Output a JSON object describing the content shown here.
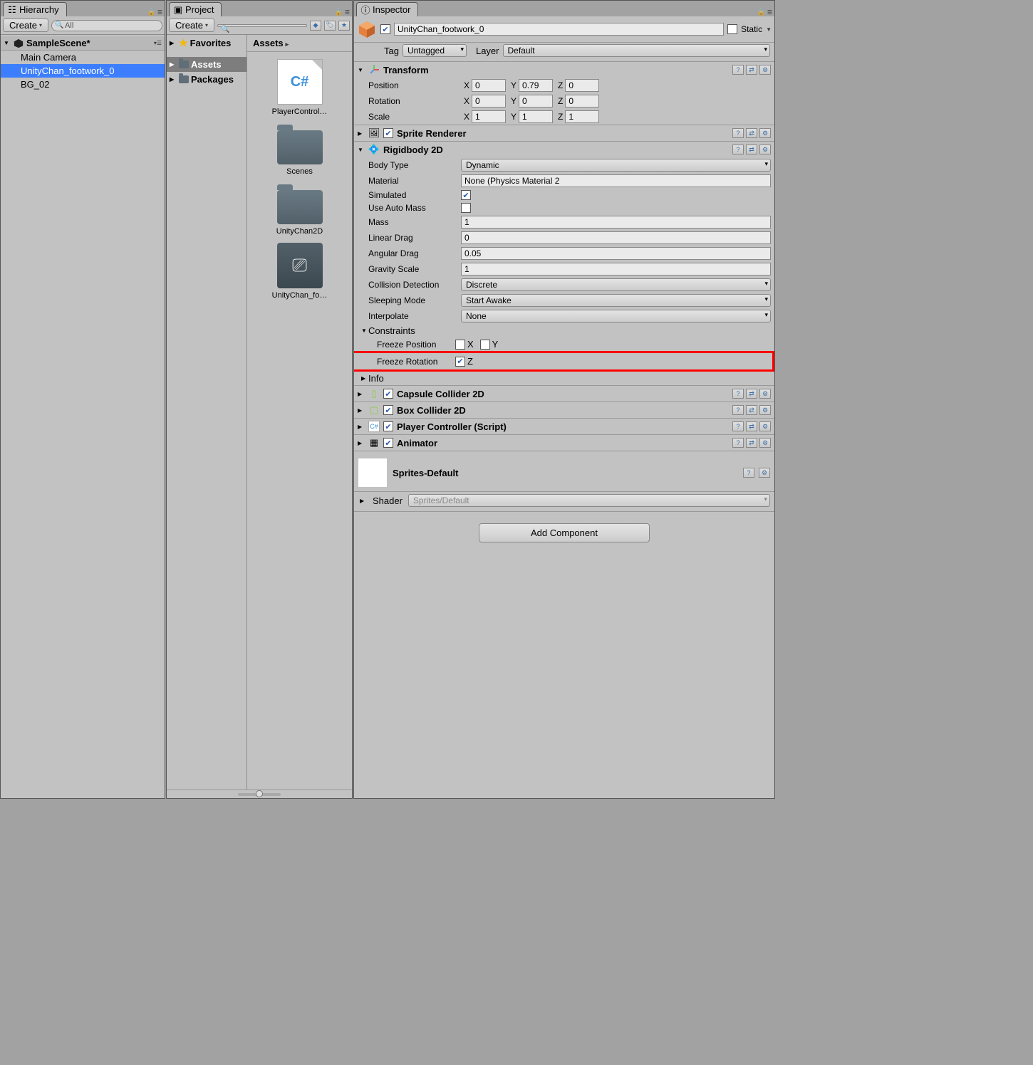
{
  "hierarchy": {
    "tab": "Hierarchy",
    "create": "Create",
    "search_placeholder": "All",
    "scene": "SampleScene*",
    "items": [
      "Main Camera",
      "UnityChan_footwork_0",
      "BG_02"
    ],
    "selected_index": 1
  },
  "project": {
    "tab": "Project",
    "create": "Create",
    "favorites": "Favorites",
    "folders": [
      "Assets",
      "Packages"
    ],
    "breadcrumb": "Assets",
    "assets": [
      {
        "type": "script",
        "label": "PlayerControl…"
      },
      {
        "type": "folder",
        "label": "Scenes"
      },
      {
        "type": "folder",
        "label": "UnityChan2D"
      },
      {
        "type": "prefab",
        "label": "UnityChan_fo…"
      }
    ]
  },
  "inspector": {
    "tab": "Inspector",
    "object_name": "UnityChan_footwork_0",
    "static_label": "Static",
    "tag_label": "Tag",
    "tag_value": "Untagged",
    "layer_label": "Layer",
    "layer_value": "Default",
    "transform": {
      "title": "Transform",
      "position": {
        "label": "Position",
        "x": "0",
        "y": "0.79",
        "z": "0"
      },
      "rotation": {
        "label": "Rotation",
        "x": "0",
        "y": "0",
        "z": "0"
      },
      "scale": {
        "label": "Scale",
        "x": "1",
        "y": "1",
        "z": "1"
      }
    },
    "sprite_renderer": {
      "title": "Sprite Renderer"
    },
    "rigidbody": {
      "title": "Rigidbody 2D",
      "body_type_label": "Body Type",
      "body_type": "Dynamic",
      "material_label": "Material",
      "material": "None (Physics Material 2",
      "simulated_label": "Simulated",
      "auto_mass_label": "Use Auto Mass",
      "mass_label": "Mass",
      "mass": "1",
      "linear_drag_label": "Linear Drag",
      "linear_drag": "0",
      "angular_drag_label": "Angular Drag",
      "angular_drag": "0.05",
      "gravity_label": "Gravity Scale",
      "gravity": "1",
      "collision_label": "Collision Detection",
      "collision": "Discrete",
      "sleep_label": "Sleeping Mode",
      "sleep": "Start Awake",
      "interpolate_label": "Interpolate",
      "interpolate": "None",
      "constraints_label": "Constraints",
      "freeze_pos_label": "Freeze Position",
      "freeze_pos_x": "X",
      "freeze_pos_y": "Y",
      "freeze_rot_label": "Freeze Rotation",
      "freeze_rot_z": "Z",
      "info_label": "Info"
    },
    "capsule": {
      "title": "Capsule Collider 2D"
    },
    "box": {
      "title": "Box Collider 2D"
    },
    "player_controller": {
      "title": "Player Controller (Script)"
    },
    "animator": {
      "title": "Animator"
    },
    "material_header": "Sprites-Default",
    "shader_label": "Shader",
    "shader_value": "Sprites/Default",
    "add_component": "Add Component"
  }
}
